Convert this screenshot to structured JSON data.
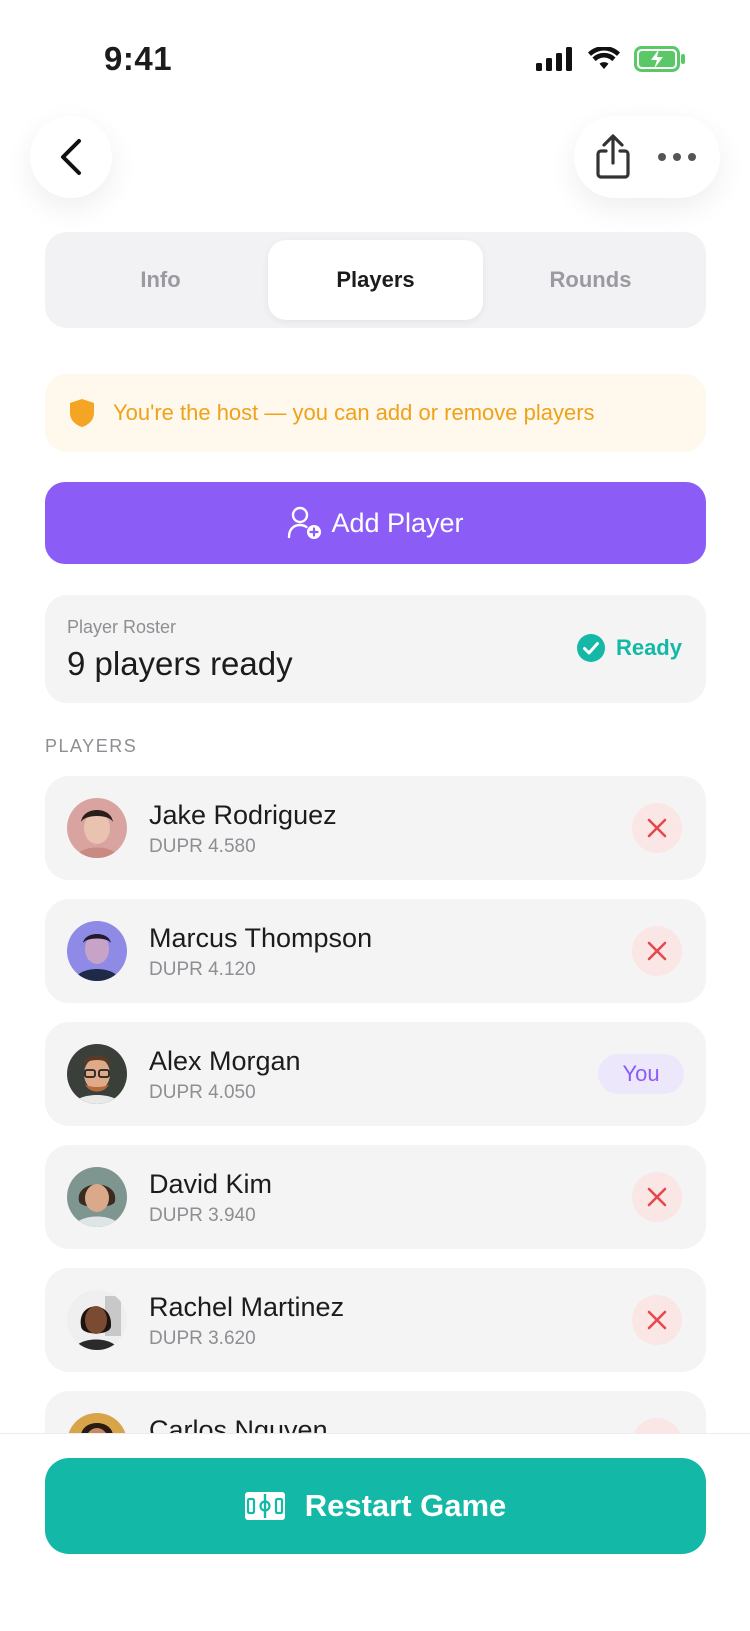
{
  "status_bar": {
    "time": "9:41",
    "icons": [
      "cellular-signal-icon",
      "wifi-icon",
      "battery-charging-icon"
    ]
  },
  "nav": {
    "back_icon": "chevron-left-icon",
    "share_icon": "share-icon",
    "more_icon": "more-horizontal-icon"
  },
  "tabs": [
    {
      "label": "Info",
      "active": false
    },
    {
      "label": "Players",
      "active": true
    },
    {
      "label": "Rounds",
      "active": false
    }
  ],
  "host_banner": {
    "icon": "shield-icon",
    "text": "You're the host — you can add or remove players"
  },
  "add_player": {
    "icon": "add-user-icon",
    "label": "Add Player"
  },
  "roster": {
    "label": "Player Roster",
    "count_text": "9 players ready",
    "status_label": "Ready",
    "status_icon": "check-circle-icon"
  },
  "section_label": "PLAYERS",
  "players": [
    {
      "name": "Jake Rodriguez",
      "rating": "DUPR 4.580",
      "is_you": false
    },
    {
      "name": "Marcus Thompson",
      "rating": "DUPR 4.120",
      "is_you": false
    },
    {
      "name": "Alex Morgan",
      "rating": "DUPR 4.050",
      "is_you": true,
      "badge": "You"
    },
    {
      "name": "David Kim",
      "rating": "DUPR 3.940",
      "is_you": false
    },
    {
      "name": "Rachel Martinez",
      "rating": "DUPR 3.620",
      "is_you": false
    },
    {
      "name": "Carlos Nguyen",
      "rating": "",
      "is_you": false
    }
  ],
  "restart": {
    "icon": "court-icon",
    "label": "Restart Game"
  },
  "colors": {
    "accent_purple": "#8b5cf6",
    "accent_teal": "#14b8a6",
    "warning_orange": "#f0a11a",
    "remove_red": "#e5484d"
  }
}
